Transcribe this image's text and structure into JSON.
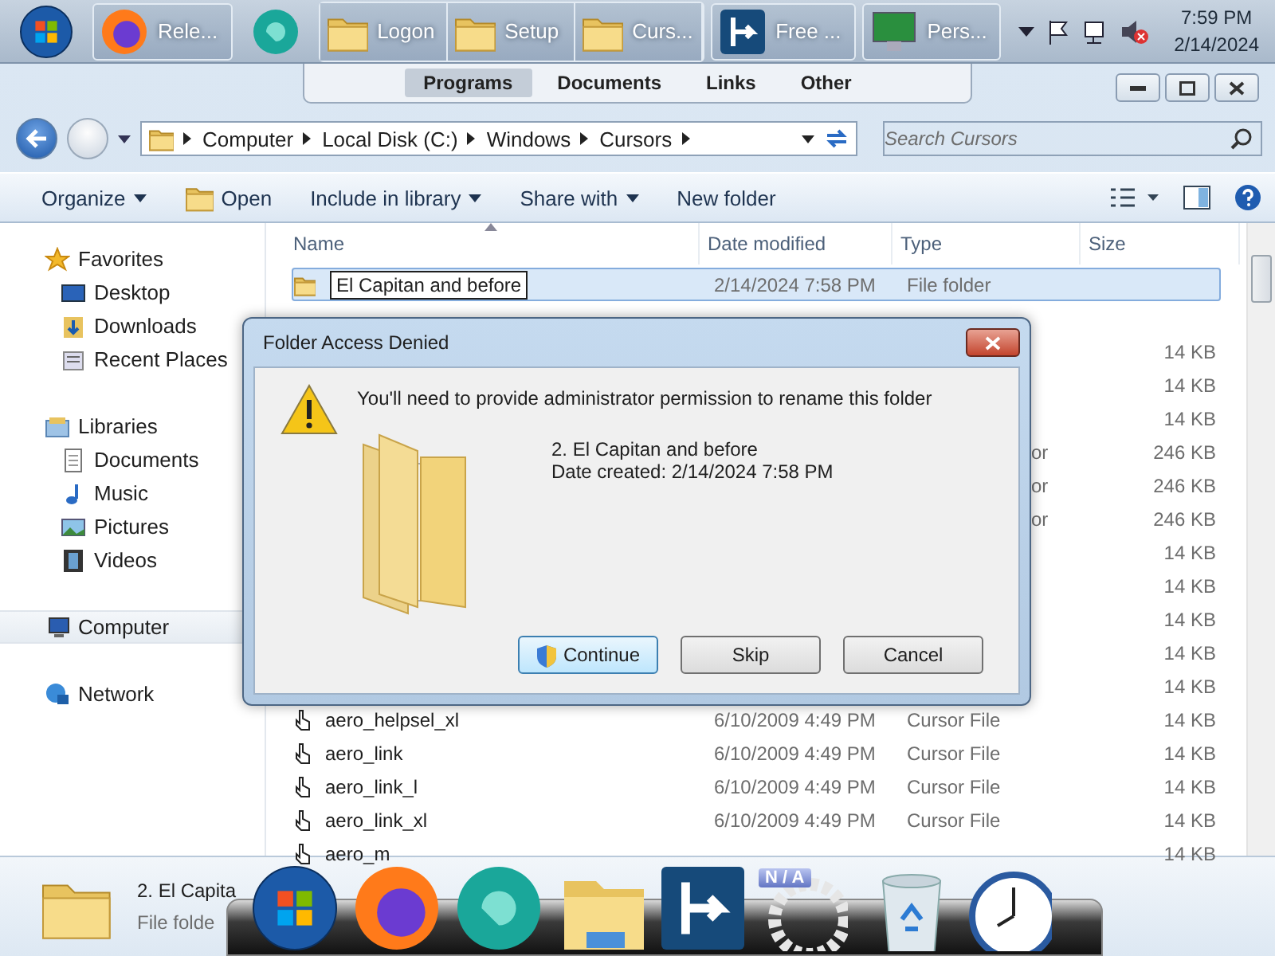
{
  "taskbar": {
    "items": [
      {
        "kind": "start"
      },
      {
        "kind": "browser",
        "label": "Rele..."
      },
      {
        "kind": "sphere"
      },
      {
        "kind": "folder-group",
        "windows": [
          {
            "label": "Logon"
          },
          {
            "label": "Setup"
          },
          {
            "label": "Curs..."
          }
        ]
      },
      {
        "kind": "arrow-app",
        "label": "Free ..."
      },
      {
        "kind": "monitor-app",
        "label": "Pers..."
      }
    ],
    "clock": {
      "time": "7:59 PM",
      "date": "2/14/2024"
    }
  },
  "jump_list": {
    "tabs": [
      {
        "label": "Programs",
        "selected": true
      },
      {
        "label": "Documents",
        "selected": false
      },
      {
        "label": "Links",
        "selected": false
      },
      {
        "label": "Other",
        "selected": false
      }
    ]
  },
  "address_bar": {
    "breadcrumb": [
      "Computer",
      "Local Disk (C:)",
      "Windows",
      "Cursors"
    ],
    "search": {
      "placeholder": "Search Cursors"
    }
  },
  "toolbar": [
    {
      "kind": "menu",
      "label": "Organize"
    },
    {
      "kind": "open",
      "label": "Open"
    },
    {
      "kind": "menu",
      "label": "Include in library"
    },
    {
      "kind": "menu",
      "label": "Share with"
    },
    {
      "kind": "plain",
      "label": "New folder"
    }
  ],
  "sidebar": {
    "items": [
      {
        "label": "Favorites",
        "kind": "star",
        "selected": false,
        "children": [
          {
            "label": "Desktop",
            "kind": "desktop",
            "selected": false
          },
          {
            "label": "Downloads",
            "kind": "downloads",
            "selected": false
          },
          {
            "label": "Recent Places",
            "kind": "recent",
            "selected": false
          }
        ]
      },
      {
        "label": "Libraries",
        "kind": "library",
        "selected": false,
        "children": [
          {
            "label": "Documents",
            "kind": "document",
            "selected": false
          },
          {
            "label": "Music",
            "kind": "music",
            "selected": false
          },
          {
            "label": "Pictures",
            "kind": "pictures",
            "selected": false
          },
          {
            "label": "Videos",
            "kind": "videos",
            "selected": false
          }
        ]
      },
      {
        "label": "Computer",
        "kind": "computer",
        "selected": true
      },
      {
        "label": "Network",
        "kind": "network",
        "selected": false
      }
    ]
  },
  "table": {
    "columns": [
      "Name",
      "Date modified",
      "Type",
      "Size"
    ],
    "rows": [
      {
        "kind": "folder",
        "name": "El Capitan and before",
        "date": "2/14/2024 7:58 PM",
        "type": "File folder",
        "selected": true,
        "renaming": true
      },
      {
        "kind": "hidden",
        "selected": false
      },
      {
        "kind": "hidden",
        "size": "14 KB",
        "selected": false
      },
      {
        "kind": "hidden",
        "size": "14 KB",
        "selected": false
      },
      {
        "kind": "hidden",
        "size": "14 KB",
        "selected": false
      },
      {
        "kind": "hidden",
        "type": "or",
        "size": "246 KB",
        "selected": false
      },
      {
        "kind": "hidden",
        "type": "or",
        "size": "246 KB",
        "selected": false
      },
      {
        "kind": "hidden",
        "type": "or",
        "size": "246 KB",
        "selected": false
      },
      {
        "kind": "hidden",
        "size": "14 KB",
        "selected": false
      },
      {
        "kind": "hidden",
        "size": "14 KB",
        "selected": false
      },
      {
        "kind": "hidden",
        "size": "14 KB",
        "selected": false
      },
      {
        "kind": "hidden",
        "size": "14 KB",
        "selected": false
      },
      {
        "kind": "hidden",
        "size": "14 KB",
        "selected": false
      },
      {
        "kind": "cursor",
        "name": "aero_helpsel_xl",
        "date": "6/10/2009 4:49 PM",
        "type": "Cursor File",
        "size": "14 KB",
        "selected": false
      },
      {
        "kind": "cursor",
        "name": "aero_link",
        "date": "6/10/2009 4:49 PM",
        "type": "Cursor File",
        "size": "14 KB",
        "selected": false
      },
      {
        "kind": "cursor",
        "name": "aero_link_l",
        "date": "6/10/2009 4:49 PM",
        "type": "Cursor File",
        "size": "14 KB",
        "selected": false
      },
      {
        "kind": "cursor",
        "name": "aero_link_xl",
        "date": "6/10/2009 4:49 PM",
        "type": "Cursor File",
        "size": "14 KB",
        "selected": false
      },
      {
        "kind": "cursor",
        "name": "aero_m",
        "size": "14 KB",
        "selected": false
      }
    ]
  },
  "details_pane": {
    "name": "2. El Capita",
    "type": "File folde"
  },
  "dialog": {
    "title": "Folder Access Denied",
    "message": "You'll need to provide administrator permission to rename this folder",
    "item_name": "2. El Capitan and before",
    "item_date": "Date created: 2/14/2024 7:58 PM",
    "buttons": [
      {
        "label": "Continue",
        "kind": "shield",
        "default": true
      },
      {
        "label": "Skip",
        "kind": "plain",
        "default": false
      },
      {
        "label": "Cancel",
        "kind": "plain",
        "default": false
      }
    ]
  },
  "dock": {
    "items": [
      {
        "kind": "start"
      },
      {
        "kind": "browser"
      },
      {
        "kind": "sphere"
      },
      {
        "kind": "explorer"
      },
      {
        "kind": "arrow-app"
      },
      {
        "kind": "gear",
        "badge": "N / A"
      },
      {
        "kind": "recycle"
      },
      {
        "kind": "clock"
      }
    ]
  }
}
